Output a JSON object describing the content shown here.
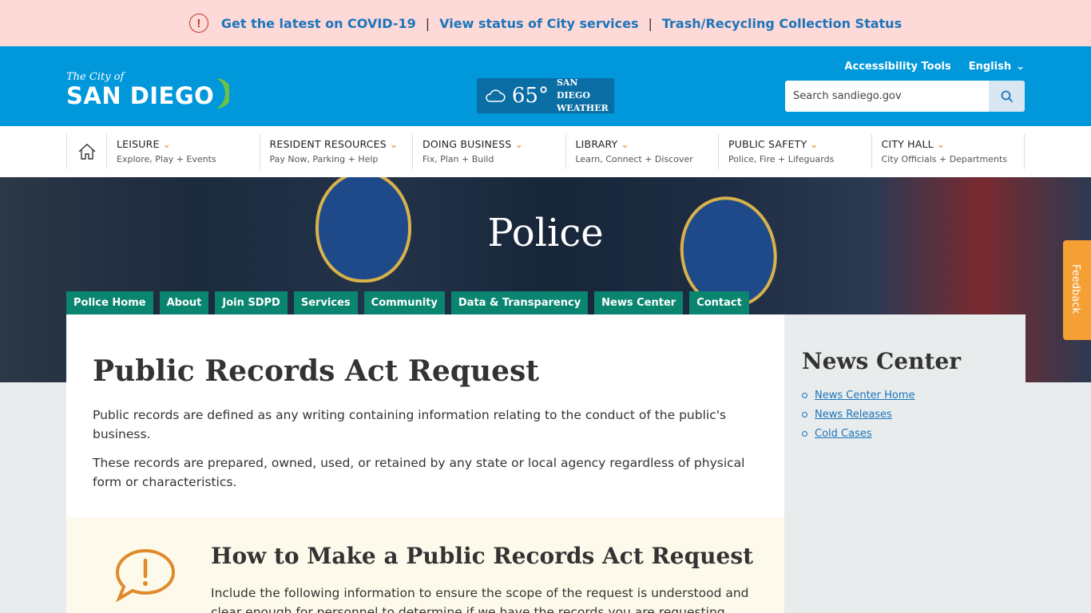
{
  "alert": {
    "links": [
      "Get the latest on COVID-19",
      "View status of City services",
      "Trash/Recycling Collection Status"
    ],
    "separator": "|"
  },
  "header": {
    "logo_small": "The City of",
    "logo_big": "SAN DIEGO",
    "weather_temp": "65°",
    "weather_line1": "SAN DIEGO",
    "weather_line2": "WEATHER",
    "accessibility": "Accessibility Tools",
    "language": "English",
    "search_placeholder": "Search sandiego.gov"
  },
  "nav": {
    "items": [
      {
        "title": "LEISURE",
        "sub": "Explore, Play + Events"
      },
      {
        "title": "RESIDENT RESOURCES",
        "sub": "Pay Now, Parking + Help"
      },
      {
        "title": "DOING BUSINESS",
        "sub": "Fix, Plan + Build"
      },
      {
        "title": "LIBRARY",
        "sub": "Learn, Connect + Discover"
      },
      {
        "title": "PUBLIC SAFETY",
        "sub": "Police, Fire + Lifeguards"
      },
      {
        "title": "CITY HALL",
        "sub": "City Officials + Departments"
      }
    ]
  },
  "hero": {
    "title": "Police",
    "subnav": [
      "Police Home",
      "About",
      "Join SDPD",
      "Services",
      "Community",
      "Data & Transparency",
      "News Center",
      "Contact"
    ]
  },
  "main": {
    "title": "Public Records Act Request",
    "para1": "Public records are defined as any writing containing information relating to the conduct of the public's business.",
    "para2": "These records are prepared, owned, used, or retained by any state or local agency regardless of physical form or characteristics.",
    "callout_title": "How to Make a Public Records Act Request",
    "callout_text": "Include the following information to ensure the scope of the request is understood and clear enough for personnel to determine if we have the records you are requesting."
  },
  "sidebar": {
    "title": "News Center",
    "links": [
      "News Center Home",
      "News Releases",
      "Cold Cases"
    ]
  },
  "feedback": "Feedback",
  "colors": {
    "header_blue": "#0098db",
    "alert_bg": "#fdd9d7",
    "subnav_green": "#0a8570",
    "accent_orange": "#f49a2c"
  }
}
